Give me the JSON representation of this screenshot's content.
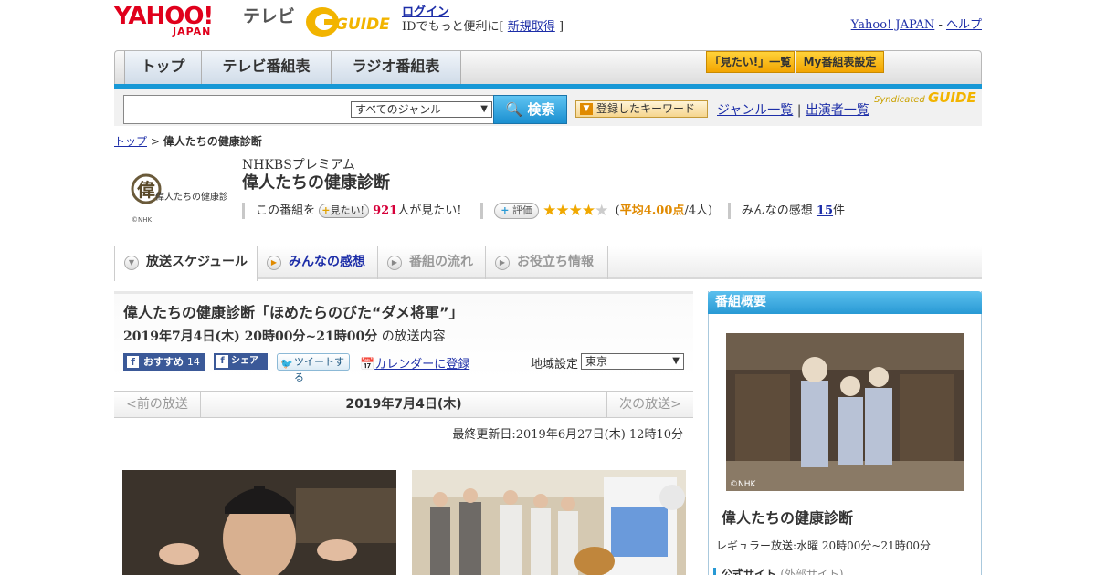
{
  "header": {
    "yahoo_logo": "YAHOO!",
    "yahoo_sub": "JAPAN",
    "tv_label": "テレビ",
    "gguide_logo": "GUIDE",
    "login_link": "ログイン",
    "login_desc": "IDでもっと便利に[",
    "signup_link": "新規取得",
    "login_close": "]",
    "yahoo_japan_link": "Yahoo! JAPAN",
    "link_sep": "-",
    "help_link": "ヘルプ"
  },
  "nav": {
    "tabs": [
      {
        "label": "トップ"
      },
      {
        "label": "テレビ番組表"
      },
      {
        "label": "ラジオ番組表"
      }
    ],
    "mitai_list": "「見たい!」一覧",
    "my_program": "My番組表設定"
  },
  "search": {
    "input_value": "",
    "genre_selected": "すべてのジャンル",
    "button": "検索",
    "keyword_button": "登録したキーワード",
    "genre_list_link": "ジャンル一覧",
    "link_sep": "|",
    "performer_list_link": "出演者一覧",
    "syndicated": "Syndicated"
  },
  "breadcrumb": {
    "top": "トップ",
    "sep": ">",
    "current": "偉人たちの健康診断"
  },
  "program": {
    "logo_text": "偉人たちの健康診断",
    "logo_credit": "©NHK",
    "channel": "NHKBSプレミアム",
    "title": "偉人たちの健康診断",
    "stat_prefix": "この番組を",
    "mitai_pill": "見たい!",
    "mitai_count": "921",
    "mitai_suffix": "人が見たい!",
    "rating_pill": "評価",
    "rating_open": "(",
    "rating_avg_label": "平均4.00点",
    "rating_people": "/4人)",
    "rating_value": 4.0,
    "rating_max": 5,
    "impressions_label": "みんなの感想",
    "impressions_count": "15",
    "impressions_suffix": "件"
  },
  "subtabs": [
    {
      "label": "放送スケジュール",
      "state": "active"
    },
    {
      "label": "みんなの感想",
      "state": "link"
    },
    {
      "label": "番組の流れ",
      "state": "disabled"
    },
    {
      "label": "お役立ち情報",
      "state": "disabled"
    }
  ],
  "episode": {
    "title": "偉人たちの健康診断「ほめたらのびた“ダメ将軍”」",
    "datetime": "2019年7月4日(木) 20時00分~21時00分",
    "datetime_suffix": "の放送内容",
    "fb_recommend": "おすすめ",
    "fb_count": "14",
    "share": "シェア",
    "tweet": "ツイートする",
    "calendar": "カレンダーに登録",
    "region_label": "地域設定",
    "region_selected": "東京"
  },
  "pager": {
    "prev": "<前の放送",
    "current": "2019年7月4日(木)",
    "next": "次の放送>"
  },
  "updated": "最終更新日:2019年6月27日(木) 12時10分",
  "sidebar": {
    "heading": "番組概要",
    "photo_credit": "©NHK",
    "title": "偉人たちの健康診断",
    "regular": "レギュラー放送:水曜 20時00分~21時00分",
    "official": "公式サイト",
    "official_note": "(外部サイト)"
  },
  "colors": {
    "accent_blue": "#1798d6",
    "link": "#1d2ea8",
    "count_red": "#d6003a",
    "star": "#f0a800"
  }
}
